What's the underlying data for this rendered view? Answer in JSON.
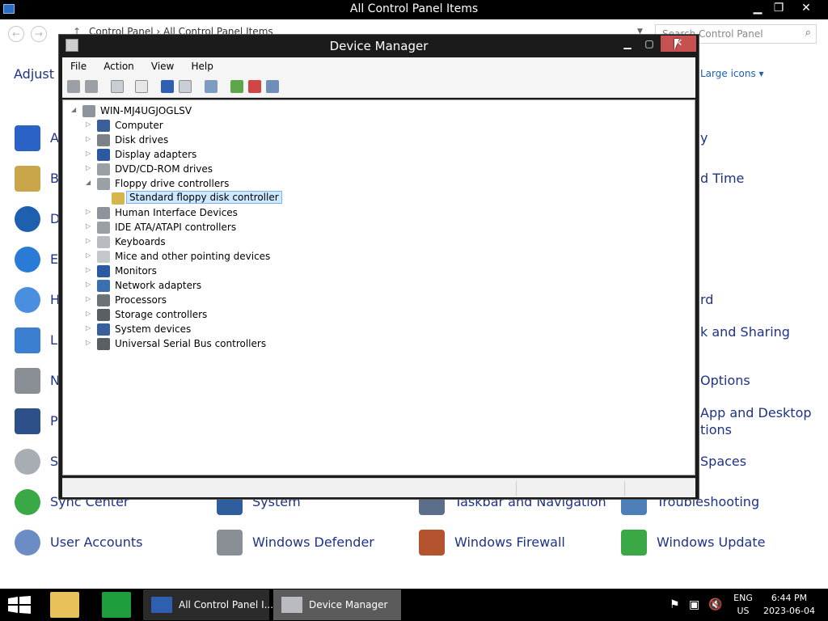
{
  "control_panel": {
    "window_title": "All Control Panel Items",
    "breadcrumb": "Control Panel  ›  All Control Panel Items",
    "search_placeholder": "Search Control Panel",
    "heading": "Adjust y",
    "view_by_value": "Large icons ▾",
    "items_left_partial": [
      "A",
      "B",
      "D",
      "E",
      "H",
      "L",
      "N",
      "P",
      "S"
    ],
    "items_right_partial": [
      "y",
      "d Time",
      "rd",
      "k and Sharing",
      "Options",
      "App and Desktop",
      "tions",
      "Spaces"
    ],
    "row_sync": [
      "Sync Center",
      "System",
      "Taskbar and Navigation",
      "Troubleshooting"
    ],
    "row_last": [
      "User Accounts",
      "Windows Defender",
      "Windows Firewall",
      "Windows Update"
    ]
  },
  "device_manager": {
    "title": "Device Manager",
    "menu": [
      "File",
      "Action",
      "View",
      "Help"
    ],
    "root": "WIN-MJ4UGJOGLSV",
    "nodes": [
      {
        "label": "Computer",
        "expanded": false
      },
      {
        "label": "Disk drives",
        "expanded": false
      },
      {
        "label": "Display adapters",
        "expanded": false
      },
      {
        "label": "DVD/CD-ROM drives",
        "expanded": false
      },
      {
        "label": "Floppy drive controllers",
        "expanded": true
      },
      {
        "label": "Standard floppy disk controller",
        "child": true,
        "selected": true
      },
      {
        "label": "Human Interface Devices",
        "expanded": false
      },
      {
        "label": "IDE ATA/ATAPI controllers",
        "expanded": false
      },
      {
        "label": "Keyboards",
        "expanded": false
      },
      {
        "label": "Mice and other pointing devices",
        "expanded": false
      },
      {
        "label": "Monitors",
        "expanded": false
      },
      {
        "label": "Network adapters",
        "expanded": false
      },
      {
        "label": "Processors",
        "expanded": false
      },
      {
        "label": "Storage controllers",
        "expanded": false
      },
      {
        "label": "System devices",
        "expanded": false
      },
      {
        "label": "Universal Serial Bus controllers",
        "expanded": false
      }
    ]
  },
  "taskbar": {
    "tasks": [
      "All Control Panel I...",
      "Device Manager"
    ],
    "lang": "ENG",
    "region": "US",
    "time": "6:44 PM",
    "date": "2023-06-04"
  }
}
